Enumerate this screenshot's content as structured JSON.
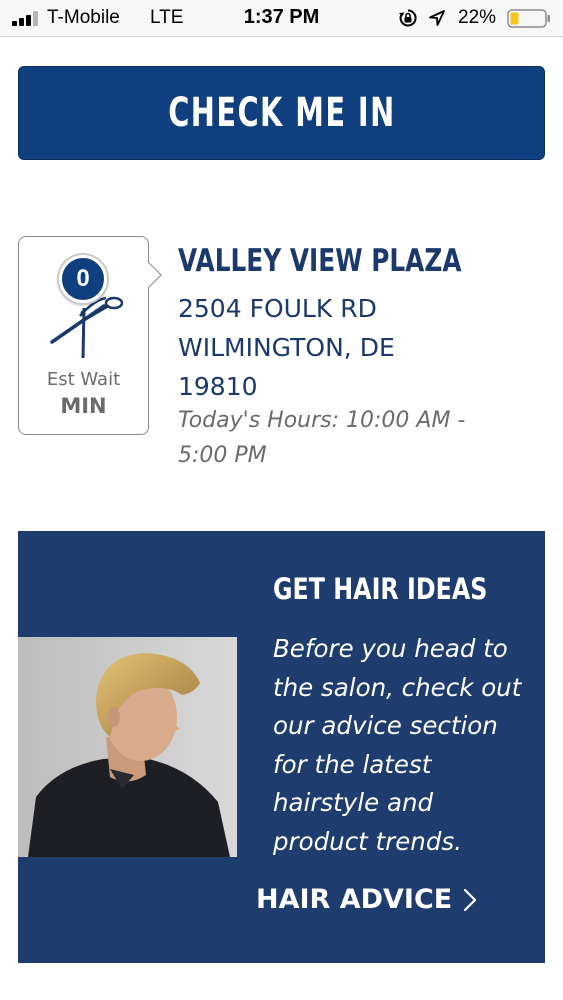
{
  "status_bar": {
    "carrier": "T-Mobile",
    "network": "LTE",
    "time": "1:37 PM",
    "battery_percent": "22%",
    "icons": [
      "signal-icon",
      "rotation-lock-icon",
      "location-arrow-icon",
      "battery-icon"
    ]
  },
  "checkin": {
    "label": "CHECK ME IN"
  },
  "wait": {
    "count": "0",
    "label": "Est Wait",
    "unit": "MIN"
  },
  "salon": {
    "name": "VALLEY VIEW PLAZA",
    "address_line1": "2504 FOULK RD",
    "address_line2": "WILMINGTON, DE",
    "address_line3": "19810",
    "hours": "Today's Hours: 10:00 AM - 5:00 PM"
  },
  "ideas": {
    "title": "GET HAIR IDEAS",
    "body": "Before you head to the salon, check out our advice section for the latest hairstyle and product trends.",
    "link_label": "HAIR ADVICE"
  },
  "colors": {
    "brand_blue": "#0f3f7e",
    "panel_blue": "#1f3c6e",
    "text_blue": "#1b3a6b"
  }
}
